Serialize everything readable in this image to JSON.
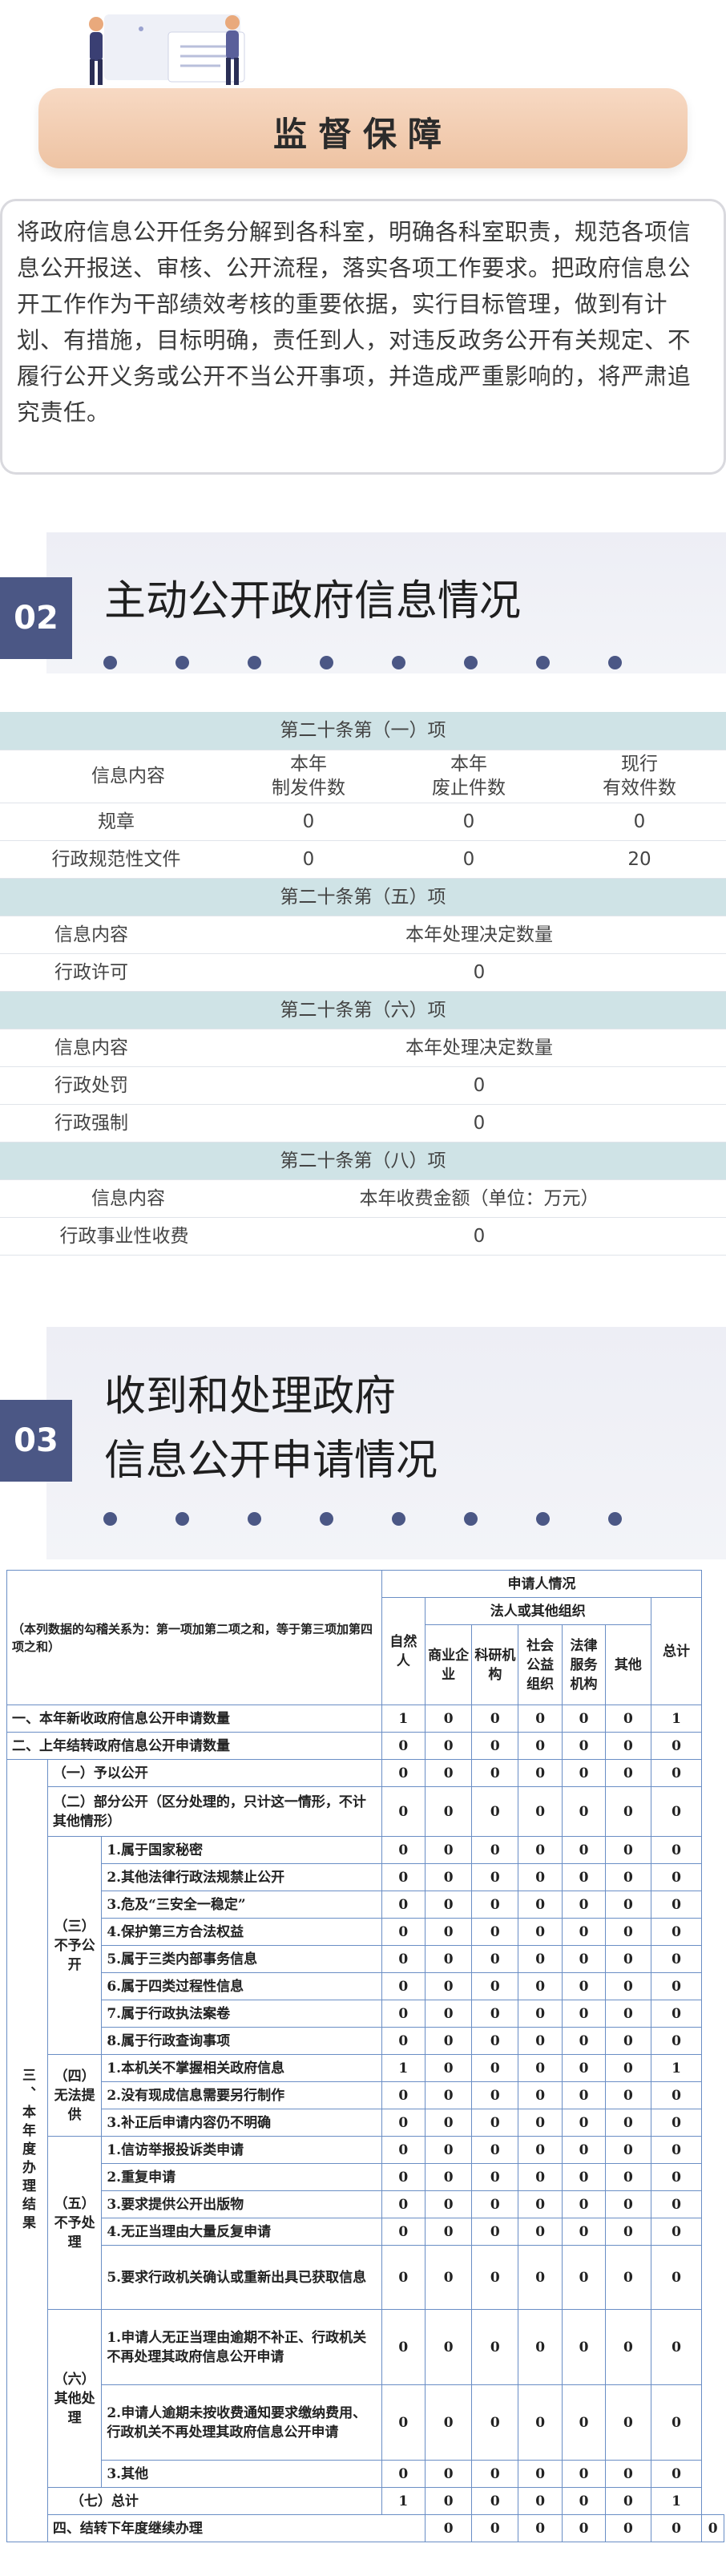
{
  "colors": {
    "accent": "#4b5785",
    "banner": "#f2cdb1",
    "table_header": "#cfe3e6",
    "grid": "#6a8ec5"
  },
  "section1": {
    "title": "监督保障",
    "body": "将政府信息公开任务分解到各科室，明确各科室职责，规范各项信息公开报送、审核、公开流程，落实各项工作要求。把政府信息公开工作作为干部绩效考核的重要依据，实行目标管理，做到有计划、有措施，目标明确，责任到人，对违反政务公开有关规定、不履行公开义务或公开不当公开事项，并造成严重影响的，将严肃追究责任。"
  },
  "section2": {
    "number": "02",
    "title": "主动公开政府信息情况"
  },
  "table1": {
    "g1": {
      "header": "第二十条第（一）项",
      "c0": "信息内容",
      "c1": "本年\n制发件数",
      "c2": "本年\n废止件数",
      "c3": "现行\n有效件数",
      "rows": [
        [
          "规章",
          "0",
          "0",
          "0"
        ],
        [
          "行政规范性文件",
          "0",
          "0",
          "20"
        ]
      ]
    },
    "g2": {
      "header": "第二十条第（五）项",
      "c0": "信息内容",
      "c1": "本年处理决定数量",
      "rows": [
        [
          "行政许可",
          "0"
        ]
      ]
    },
    "g3": {
      "header": "第二十条第（六）项",
      "c0": "信息内容",
      "c1": "本年处理决定数量",
      "rows": [
        [
          "行政处罚",
          "0"
        ],
        [
          "行政强制",
          "0"
        ]
      ]
    },
    "g4": {
      "header": "第二十条第（八）项",
      "c0": "信息内容",
      "c1": "本年收费金额（单位：万元）",
      "rows": [
        [
          "行政事业性收费",
          "0"
        ]
      ]
    }
  },
  "section3": {
    "number": "03",
    "title_line1": "收到和处理政府",
    "title_line2": "信息公开申请情况"
  },
  "table2": {
    "note": "（本列数据的勾稽关系为：第一项加第二项之和，等于第三项加第四项之和）",
    "h_applicant": "申请人情况",
    "h_natural": "自然人",
    "h_legal": "法人或其他组织",
    "h_total": "总计",
    "h_sub": [
      "商业企业",
      "科研机构",
      "社会公益组织",
      "法律服务机构",
      "其他"
    ],
    "r1": "一、本年新收政府信息公开申请数量",
    "r2": "二、上年结转政府信息公开申请数量",
    "r3": "三、本年度办理结果",
    "g1": "（一）予以公开",
    "g2": "（二）部分公开（区分处理的，只计这一情形，不计其他情形）",
    "g3": "（三）不予公开",
    "g3items": [
      "1.属于国家秘密",
      "2.其他法律行政法规禁止公开",
      "3.危及“三安全一稳定”",
      "4.保护第三方合法权益",
      "5.属于三类内部事务信息",
      "6.属于四类过程性信息",
      "7.属于行政执法案卷",
      "8.属于行政查询事项"
    ],
    "g4": "（四）无法提供",
    "g4items": [
      "1.本机关不掌握相关政府信息",
      "2.没有现成信息需要另行制作",
      "3.补正后申请内容仍不明确"
    ],
    "g5": "（五）不予处理",
    "g5items": [
      "1.信访举报投诉类申请",
      "2.重复申请",
      "3.要求提供公开出版物",
      "4.无正当理由大量反复申请",
      "5.要求行政机关确认或重新出具已获取信息"
    ],
    "g6": "（六）其他处理",
    "g6items": [
      "1.申请人无正当理由逾期不补正、行政机关不再处理其政府信息公开申请",
      "2.申请人逾期未按收费通知要求缴纳费用、行政机关不再处理其政府信息公开申请",
      "3.其他"
    ],
    "g7": "（七）总计",
    "r4": "四、结转下年度继续办理",
    "v1": [
      "1",
      "0",
      "0",
      "0",
      "0",
      "0",
      "1"
    ],
    "v0": [
      "0",
      "0",
      "0",
      "0",
      "0",
      "0",
      "0"
    ],
    "v4a": [
      "1",
      "0",
      "0",
      "0",
      "0",
      "0",
      "1"
    ],
    "v7": [
      "1",
      "0",
      "0",
      "0",
      "0",
      "0",
      "1"
    ]
  }
}
